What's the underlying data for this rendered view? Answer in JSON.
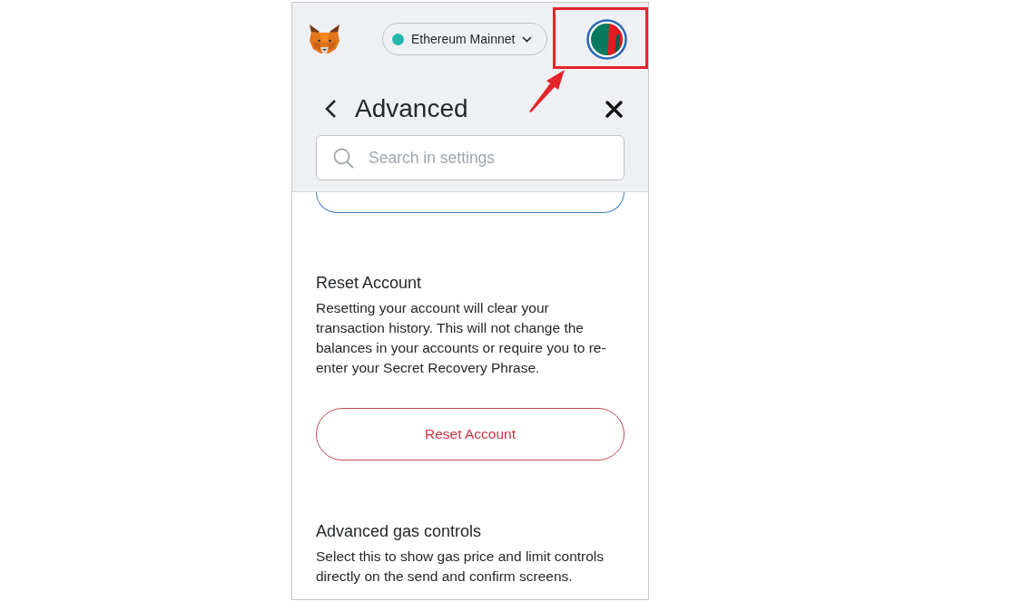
{
  "header": {
    "network": {
      "label": "Ethereum Mainnet"
    }
  },
  "settings": {
    "title": "Advanced",
    "search": {
      "placeholder": "Search in settings"
    }
  },
  "sections": [
    {
      "title": "Reset Account",
      "description": "Resetting your account will clear your transaction history. This will not change the balances in your accounts or require you to re-enter your Secret Recovery Phrase.",
      "button": {
        "label": "Reset Account"
      }
    },
    {
      "title": "Advanced gas controls",
      "description": "Select this to show gas price and limit controls directly on the send and confirm screens."
    }
  ]
}
